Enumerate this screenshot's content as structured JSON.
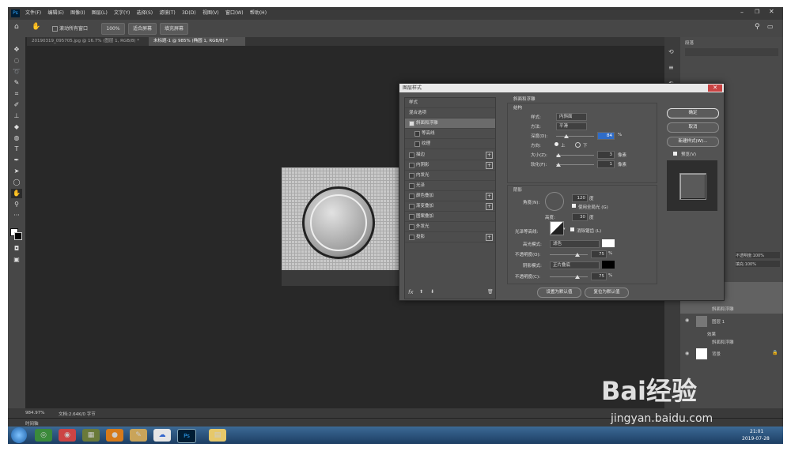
{
  "app": {
    "logo": "Ps"
  },
  "menus": [
    "文件(F)",
    "编辑(E)",
    "图像(I)",
    "图层(L)",
    "文字(Y)",
    "选择(S)",
    "滤镜(T)",
    "3D(D)",
    "视图(V)",
    "窗口(W)",
    "帮助(H)"
  ],
  "options_bar": {
    "scroll_all": "滚动所有窗口",
    "zoom": "100%",
    "fit": "适合屏幕",
    "fill": "填充屏幕"
  },
  "doc_tabs": [
    {
      "label": "20190319_095705.jpg @ 16.7% (图层 1, RGB/8) *"
    },
    {
      "label": "未标题-1 @ 985% (椭圆 1, RGB/8) *"
    }
  ],
  "status": {
    "zoom": "984.97%",
    "doc": "文档:2.64K/0 字节",
    "timeline": "时间轴"
  },
  "panels": {
    "paragraph": "段落",
    "layers": [
      {
        "name": "斜面和浮雕"
      },
      {
        "name": "图层 1"
      },
      {
        "name": "效果"
      },
      {
        "name": "斜面和浮雕"
      },
      {
        "name": "背景"
      }
    ],
    "opacity": "不透明度:100%",
    "fill": "填充:100%"
  },
  "dialog": {
    "title": "图层样式",
    "list": [
      {
        "label": "样式",
        "type": "header"
      },
      {
        "label": "混合选项",
        "type": "header"
      },
      {
        "label": "斜面和浮雕",
        "checked": true,
        "selected": true
      },
      {
        "label": "等高线",
        "sub": true
      },
      {
        "label": "纹理",
        "sub": true
      },
      {
        "label": "描边",
        "plus": true
      },
      {
        "label": "内阴影",
        "plus": true
      },
      {
        "label": "内发光"
      },
      {
        "label": "光泽"
      },
      {
        "label": "颜色叠加",
        "plus": true
      },
      {
        "label": "渐变叠加",
        "plus": true
      },
      {
        "label": "图案叠加"
      },
      {
        "label": "外发光"
      },
      {
        "label": "投影",
        "plus": true
      }
    ],
    "bevel": {
      "section": "斜面和浮雕",
      "structure": "结构",
      "style_label": "样式:",
      "style_value": "内斜面",
      "technique_label": "方法:",
      "technique_value": "平滑",
      "depth_label": "深度(D):",
      "depth_value": "84",
      "pct": "%",
      "direction_label": "方向:",
      "dir_up": "上",
      "dir_down": "下",
      "size_label": "大小(Z):",
      "size_value": "3",
      "px": "像素",
      "soften_label": "软化(F):",
      "soften_value": "1",
      "px2": "像素"
    },
    "shading": {
      "section": "阴影",
      "angle_label": "角度(N):",
      "angle_value": "120",
      "deg": "度",
      "global_light": "使用全局光 (G)",
      "altitude_label": "高度:",
      "altitude_value": "30",
      "deg2": "度",
      "gloss_label": "光泽等高线:",
      "antialias": "消除锯齿 (L)",
      "highlight_label": "高光模式:",
      "highlight_value": "滤色",
      "hl_opacity_label": "不透明度(O):",
      "hl_opacity_value": "75",
      "pct1": "%",
      "shadow_label": "阴影模式:",
      "shadow_value": "正片叠底",
      "sh_opacity_label": "不透明度(C):",
      "sh_opacity_value": "75",
      "pct2": "%"
    },
    "make_default": "设置为默认值",
    "reset_default": "复位为默认值",
    "ok": "确定",
    "cancel": "取消",
    "new_style": "新建样式(W)...",
    "preview": "预览(V)"
  },
  "taskbar": {
    "time": "21:01",
    "date": "2019-07-28"
  },
  "watermark": {
    "brand": "Bai经验",
    "url": "jingyan.baidu.com"
  }
}
